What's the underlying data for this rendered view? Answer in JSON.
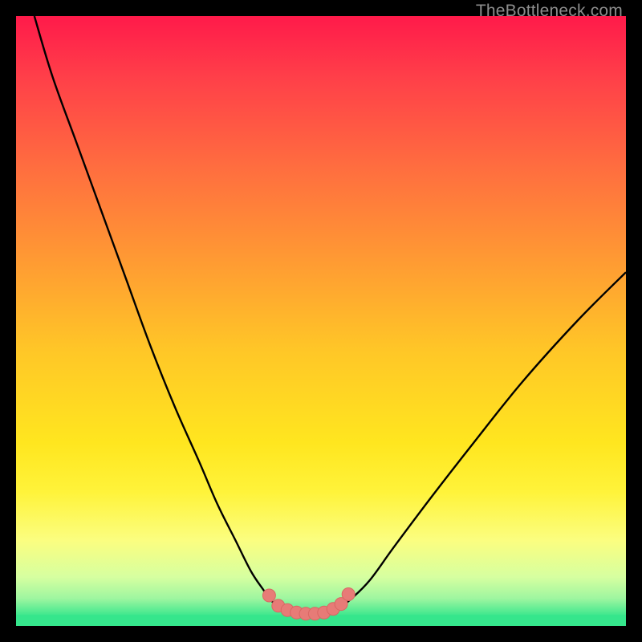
{
  "watermark": "TheBottleneck.com",
  "colors": {
    "frame": "#000000",
    "curve": "#000000",
    "markers_fill": "#e77b77",
    "markers_stroke": "#d96763",
    "green_band": "#35e68c",
    "gradient_stops": [
      {
        "offset": 0.0,
        "color": "#ff1a4a"
      },
      {
        "offset": 0.1,
        "color": "#ff3f49"
      },
      {
        "offset": 0.25,
        "color": "#ff6e3f"
      },
      {
        "offset": 0.4,
        "color": "#ff9a33"
      },
      {
        "offset": 0.55,
        "color": "#ffc727"
      },
      {
        "offset": 0.7,
        "color": "#ffe61f"
      },
      {
        "offset": 0.78,
        "color": "#fff33a"
      },
      {
        "offset": 0.86,
        "color": "#fbfe80"
      },
      {
        "offset": 0.92,
        "color": "#d6ffa0"
      },
      {
        "offset": 0.955,
        "color": "#9ef6a0"
      },
      {
        "offset": 0.985,
        "color": "#35e68c"
      },
      {
        "offset": 1.0,
        "color": "#35e68c"
      }
    ]
  },
  "chart_data": {
    "type": "line",
    "title": "",
    "xlabel": "",
    "ylabel": "",
    "xlim": [
      0,
      100
    ],
    "ylim": [
      0,
      100
    ],
    "series": [
      {
        "name": "bottleneck-curve",
        "x": [
          3,
          6,
          10,
          14,
          18,
          22,
          26,
          30,
          33,
          36,
          38.5,
          40.5,
          42,
          43.5,
          45,
          47,
          49,
          51,
          53,
          55,
          58,
          62,
          68,
          75,
          83,
          92,
          100
        ],
        "y": [
          100,
          90,
          79,
          68,
          57,
          46,
          36,
          27,
          20,
          14,
          9,
          6,
          4,
          2.8,
          2.2,
          2.0,
          2.0,
          2.2,
          3.0,
          4.5,
          7.5,
          13,
          21,
          30,
          40,
          50,
          58
        ]
      }
    ],
    "markers": {
      "name": "valley-markers",
      "x": [
        41.5,
        43,
        44.5,
        46,
        47.5,
        49,
        50.5,
        52,
        53.3,
        54.5
      ],
      "y": [
        5.0,
        3.3,
        2.6,
        2.2,
        2.0,
        2.0,
        2.2,
        2.8,
        3.6,
        5.2
      ]
    }
  }
}
